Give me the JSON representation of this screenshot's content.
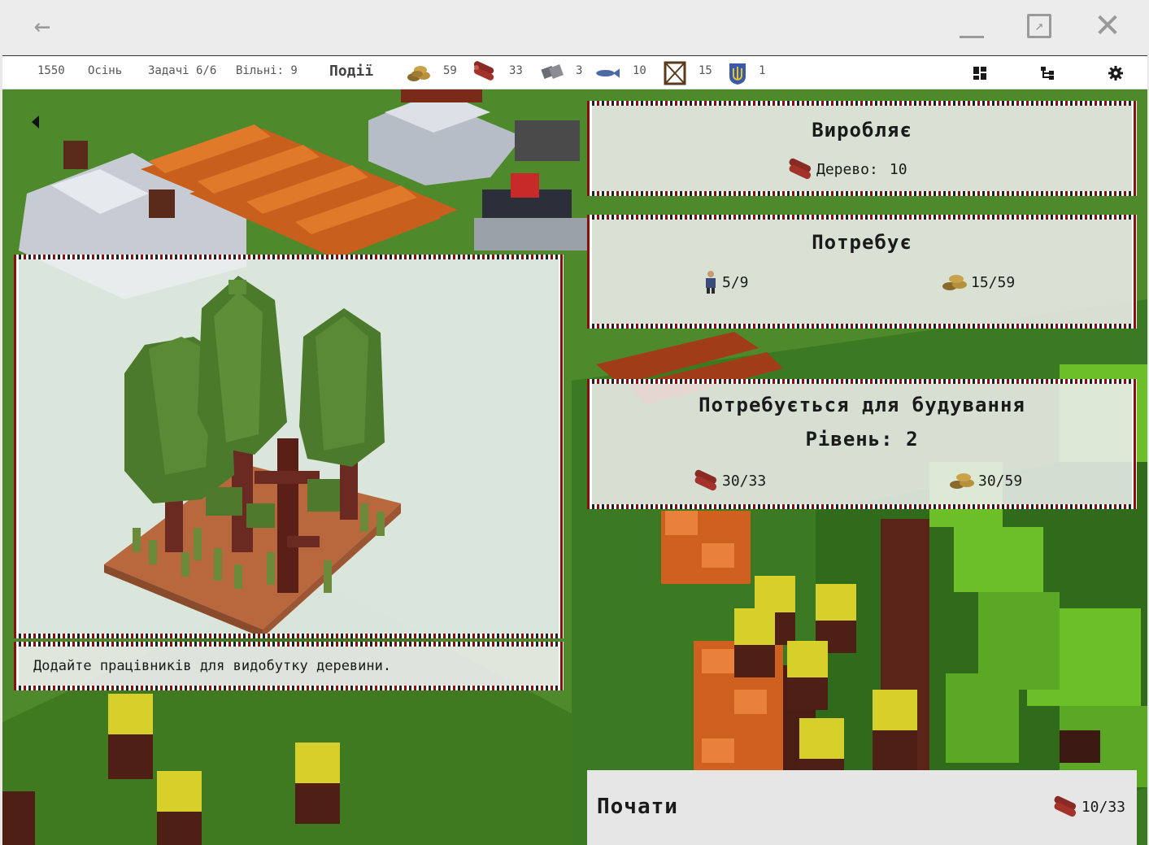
{
  "window": {
    "back_icon": "arrow-left-icon",
    "minimize_icon": "minimize-icon",
    "maximize_icon": "maximize-icon",
    "close_icon": "close-icon"
  },
  "topbar": {
    "year": "1550",
    "season": "Осінь",
    "tasks": "Задачі 6/6",
    "free": "Вільні: 9",
    "events": "Події",
    "resources": [
      {
        "icon": "coins-icon",
        "value": "59"
      },
      {
        "icon": "wood-logs-icon",
        "value": "33"
      },
      {
        "icon": "stone-icon",
        "value": "3"
      },
      {
        "icon": "fish-icon",
        "value": "10"
      },
      {
        "icon": "loom-icon",
        "value": "15"
      },
      {
        "icon": "trident-emblem-icon",
        "value": "1"
      }
    ],
    "tools": [
      "grid-icon",
      "tree-structure-icon",
      "gear-icon"
    ]
  },
  "produces": {
    "title": "Виробляє",
    "item_label": "Дерево:",
    "item_value": "10"
  },
  "requires": {
    "title": "Потребує",
    "workers": "5/9",
    "coins": "15/59"
  },
  "build": {
    "title": "Потребується для будування",
    "level": "Рівень: 2",
    "wood": "30/33",
    "coins": "30/59"
  },
  "hint": {
    "text": "Додайте працівників для видобутку деревини."
  },
  "start": {
    "label": "Почати",
    "wood_cost": "10/33"
  },
  "colors": {
    "grass": "#4f8a2a",
    "wood_red": "#8a2a24",
    "ornament_red": "#8a1010",
    "panel_bg": "#f0f0f0"
  }
}
